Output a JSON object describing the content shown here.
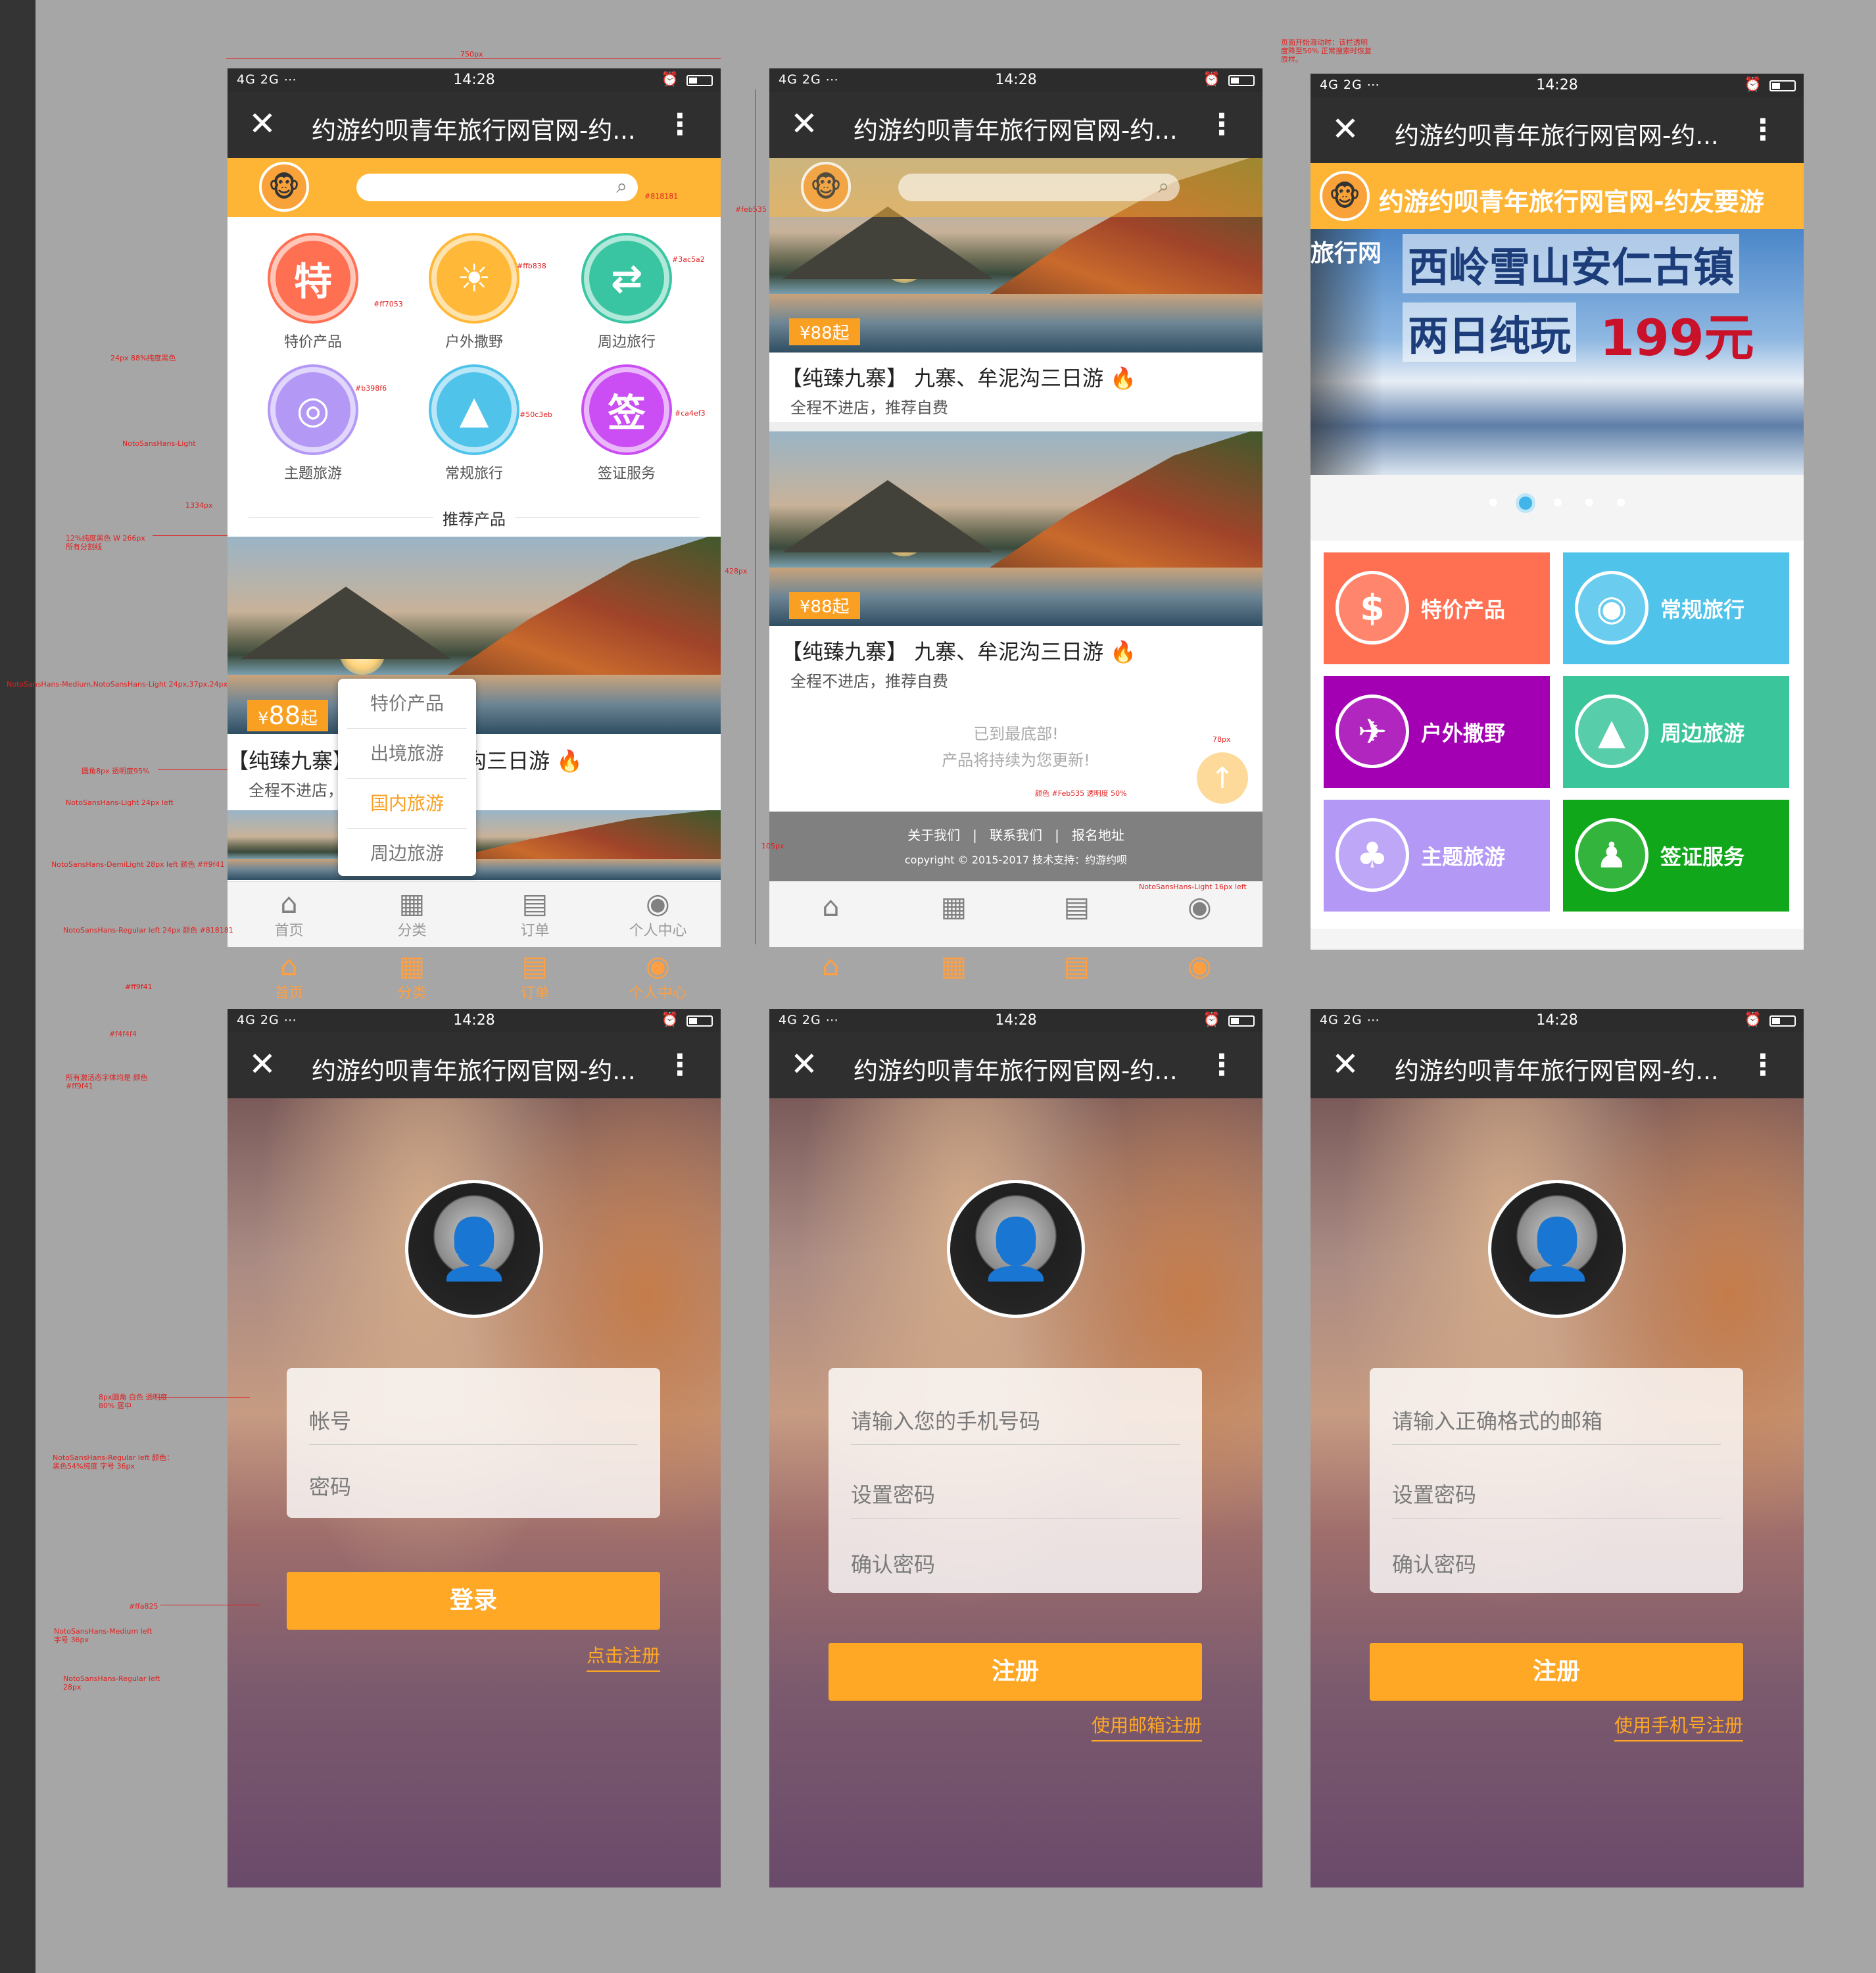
{
  "status": {
    "signal": "4G 2G ⋯",
    "time": "14:28"
  },
  "titlebar": {
    "title": "约游约呗青年旅行网官网-约..."
  },
  "home": {
    "categories": [
      {
        "label": "特价产品",
        "glyph": "特",
        "color": "#ff7053"
      },
      {
        "label": "户外撒野",
        "glyph": "☀",
        "color": "#ffb838"
      },
      {
        "label": "周边旅行",
        "glyph": "⇄",
        "color": "#3ac5a2"
      },
      {
        "label": "主题旅游",
        "glyph": "◎",
        "color": "#b398f6"
      },
      {
        "label": "常规旅行",
        "glyph": "▲",
        "color": "#50c3eb"
      },
      {
        "label": "签证服务",
        "glyph": "签",
        "color": "#ca4ef3"
      }
    ],
    "section": "推荐产品",
    "price_cur": "¥",
    "price": "88",
    "price_unit": "起",
    "product_title": "【纯臻九寨】 九寨、牟泥沟三日游",
    "product_sub": "全程不进店，推荐自费",
    "popup": [
      "特价产品",
      "出境旅游",
      "国内旅游",
      "周边旅游"
    ],
    "tabs": [
      "首页",
      "分类",
      "订单",
      "个人中心"
    ]
  },
  "list": {
    "product_title": "【纯臻九寨】 九寨、牟泥沟三日游",
    "product_sub": "全程不进店，推荐自费",
    "price": "¥88起",
    "end1": "已到最底部!",
    "end2": "产品将持续为您更新!",
    "footer_links": [
      "关于我们",
      "联系我们",
      "报名地址"
    ],
    "copyright": "copyright © 2015-2017  技术支持：约游约呗"
  },
  "alt": {
    "brand": "约游约呗青年旅行网官网-约友要游",
    "banner_small": "旅行网",
    "banner_line1": "西岭雪山安仁古镇",
    "banner_line2": "两日纯玩",
    "banner_price": "199元",
    "tiles": [
      {
        "label": "特价产品",
        "glyph": "$",
        "color": "#ff7053"
      },
      {
        "label": "常规旅行",
        "glyph": "◉",
        "color": "#50c3eb"
      },
      {
        "label": "户外撒野",
        "glyph": "✈",
        "color": "#a300b3"
      },
      {
        "label": "周边旅游",
        "glyph": "▲",
        "color": "#3ac59a"
      },
      {
        "label": "主题旅游",
        "glyph": "♣",
        "color": "#b398f6"
      },
      {
        "label": "签证服务",
        "glyph": "♟",
        "color": "#10a71a"
      }
    ]
  },
  "login": {
    "account": "帐号",
    "password": "密码",
    "button": "登录",
    "register_link": "点击注册"
  },
  "reg_phone": {
    "phone": "请输入您的手机号码",
    "pwd": "设置密码",
    "pwd2": "确认密码",
    "button": "注册",
    "link": "使用邮箱注册"
  },
  "reg_email": {
    "email": "请输入正确格式的邮箱",
    "pwd": "设置密码",
    "pwd2": "确认密码",
    "button": "注册",
    "link": "使用手机号注册"
  },
  "annotations": [
    "750px",
    "#feb535",
    "#818181",
    "#ff7053",
    "#ffb838",
    "#3ac5a2",
    "#b398f6",
    "#50c3eb",
    "#ca4ef3",
    "24px 88%纯度黑色",
    "NotoSansHans-Light",
    "12%纯度黑色 W 266px 所有分割线",
    "NotoSansHans-Medium,NotoSansHans-Light 24px,37px,24px",
    "圆角8px 透明度95%",
    "NotoSansHans-Light 24px left",
    "NotoSansHans-DemiLight 28px left 颜色 #ff9f41",
    "NotoSansHans-Regular left 24px 颜色 #818181",
    "#ff9f41",
    "#f4f4f4",
    "所有激活态字体均是 颜色 #ff9f41",
    "8px圆角 白色 透明度80% 居中",
    "NotoSansHans-Regular left 颜色：黑色54%纯度 字号 36px",
    "#ffa825",
    "NotoSansHans-Medium left 字号 36px",
    "NotoSansHans-Regular left 28px",
    "页面开始滑动时：该栏透明度降至50% 正常搜索时恢复原样。",
    "1334px",
    "428px",
    "NotoSansHans-Light 16px left",
    "颜色 #Feb535 透明度 50%",
    "78px",
    "105px"
  ]
}
